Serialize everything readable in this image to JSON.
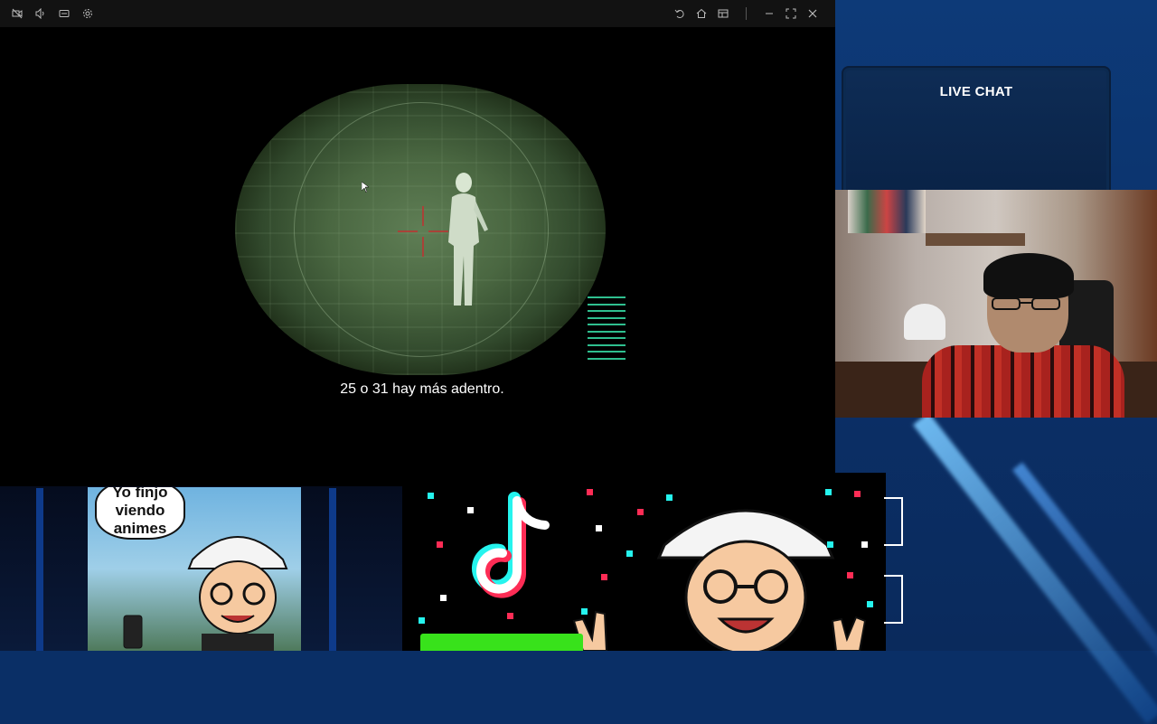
{
  "player": {
    "subtitle": "25 o 31 hay más adentro.",
    "toolbar_left": [
      {
        "name": "no-video-icon"
      },
      {
        "name": "volume-icon"
      },
      {
        "name": "captions-icon"
      },
      {
        "name": "settings-icon"
      }
    ],
    "toolbar_right": [
      {
        "name": "rotate-icon"
      },
      {
        "name": "home-icon"
      },
      {
        "name": "layout-icon"
      },
      {
        "name": "minimize-icon"
      },
      {
        "name": "fullscreen-icon"
      },
      {
        "name": "close-icon"
      }
    ]
  },
  "chat": {
    "title": "LIVE CHAT"
  },
  "comic": {
    "speech_lines": [
      "Yo finjo",
      "viendo",
      "animes"
    ]
  },
  "colors": {
    "chat_bg": "#0e2c55",
    "accent_green": "#38e21b",
    "scope_green": "#4a6741",
    "bar_teal": "#2fbf8f",
    "tiktok_cyan": "#25f4ee",
    "tiktok_red": "#fe2c55"
  }
}
